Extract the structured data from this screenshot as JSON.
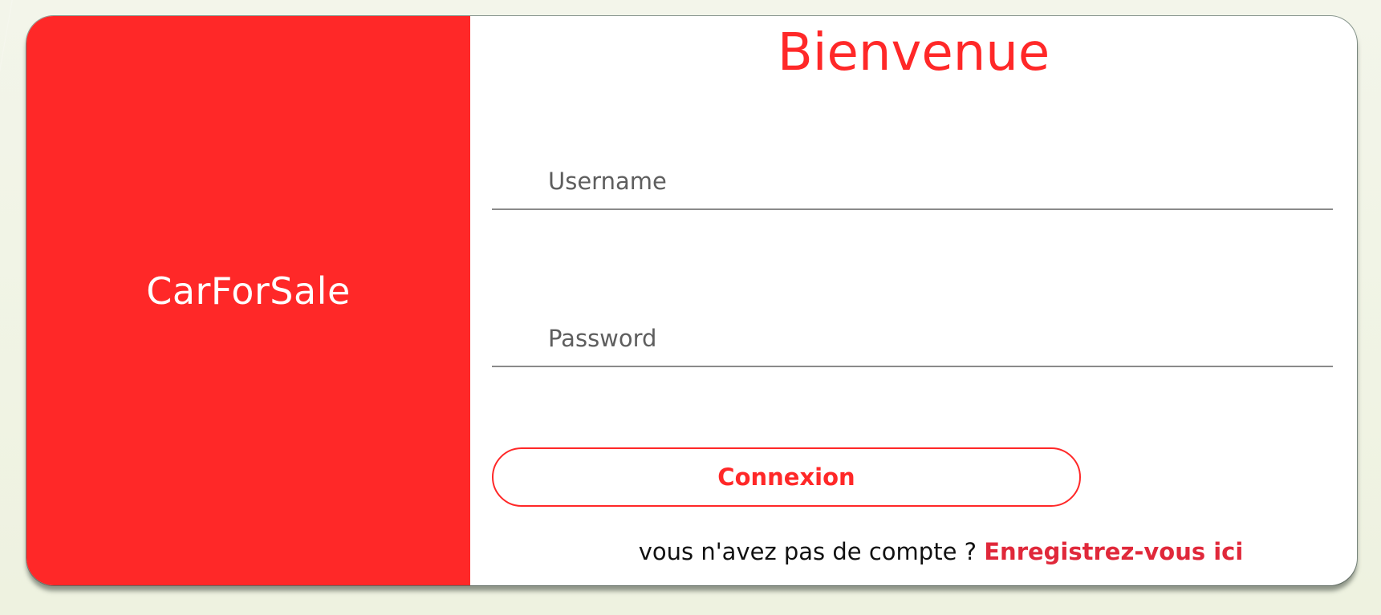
{
  "brand": {
    "name": "CarForSale",
    "color": "#ff2828"
  },
  "form": {
    "title": "Bienvenue",
    "username_placeholder": "Username",
    "username_value": "",
    "password_placeholder": "Password",
    "password_value": "",
    "submit_label": "Connexion",
    "register_prompt": "vous n'avez pas de compte ?",
    "register_link": "Enregistrez-vous ici"
  }
}
